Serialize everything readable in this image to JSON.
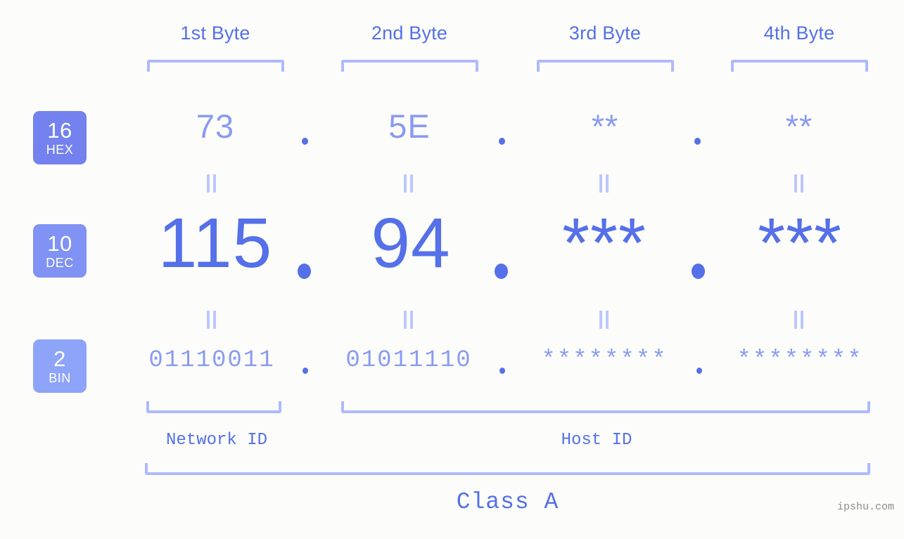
{
  "background_color": "#fcfdfa",
  "accent_color": "#5570e8",
  "light_accent_color": "#8a9bf0",
  "bracket_color": "#aebafc",
  "byte_headers": [
    {
      "label": "1st Byte"
    },
    {
      "label": "2nd Byte"
    },
    {
      "label": "3rd Byte"
    },
    {
      "label": "4th Byte"
    }
  ],
  "bases": [
    {
      "key": "hex",
      "number": "16",
      "name": "HEX",
      "badge_color": "#7382ee"
    },
    {
      "key": "dec",
      "number": "10",
      "name": "DEC",
      "badge_color": "#8092f3"
    },
    {
      "key": "bin",
      "number": "2",
      "name": "BIN",
      "badge_color": "#8ea4f8"
    }
  ],
  "rows": {
    "hex": {
      "values": [
        "73",
        "5E",
        "**",
        "**"
      ]
    },
    "dec": {
      "values": [
        "115",
        "94",
        "***",
        "***"
      ]
    },
    "bin": {
      "values": [
        "01110011",
        "01011110",
        "********",
        "********"
      ]
    }
  },
  "separator": ".",
  "equality_symbol": "=",
  "id_sections": [
    {
      "label": "Network ID"
    },
    {
      "label": "Host ID"
    }
  ],
  "class_label": "Class A",
  "watermark": "ipshu.com"
}
